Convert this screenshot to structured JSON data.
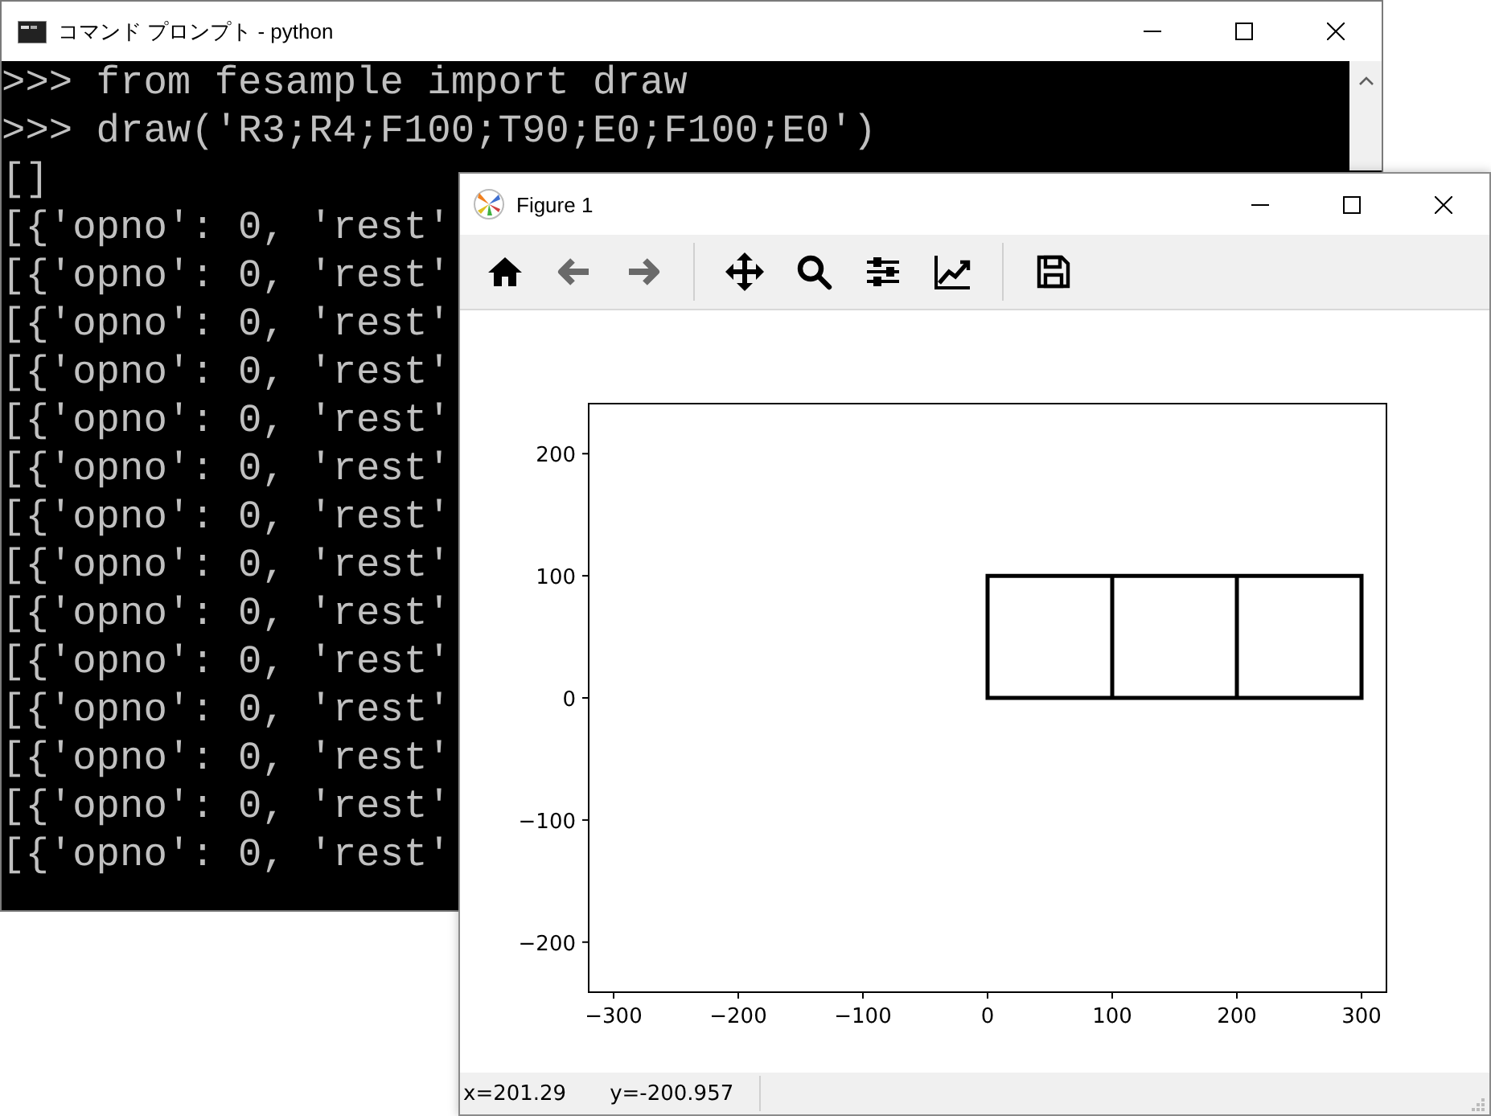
{
  "console_window": {
    "title": "コマンド プロンプト - python",
    "lines": [
      ">>> from fesample import draw",
      ">>> draw('R3;R4;F100;T90;E0;F100;E0')",
      "[]",
      "[{'opno': 0, 'rest'",
      "[{'opno': 0, 'rest'",
      "[{'opno': 0, 'rest'",
      "[{'opno': 0, 'rest'",
      "[{'opno': 0, 'rest'",
      "[{'opno': 0, 'rest'",
      "[{'opno': 0, 'rest'",
      "[{'opno': 0, 'rest'",
      "[{'opno': 0, 'rest'",
      "[{'opno': 0, 'rest'",
      "[{'opno': 0, 'rest'",
      "[{'opno': 0, 'rest'",
      "[{'opno': 0, 'rest'",
      "[{'opno': 0, 'rest'"
    ]
  },
  "figure_window": {
    "title": "Figure 1",
    "toolbar": [
      {
        "kind": "home",
        "disabled": false
      },
      {
        "kind": "back",
        "disabled": true
      },
      {
        "kind": "forward",
        "disabled": true
      },
      {
        "kind": "separator"
      },
      {
        "kind": "pan",
        "disabled": false
      },
      {
        "kind": "zoom",
        "disabled": false
      },
      {
        "kind": "subplots",
        "disabled": false
      },
      {
        "kind": "axes",
        "disabled": false
      },
      {
        "kind": "separator"
      },
      {
        "kind": "save",
        "disabled": false
      }
    ],
    "chart_data": {
      "type": "line",
      "x": [
        0,
        300,
        300,
        0,
        0,
        100,
        100,
        200,
        200
      ],
      "series": [
        {
          "color": "#000000",
          "values": [
            0,
            0,
            100,
            100,
            0,
            0,
            100,
            100,
            0
          ]
        }
      ],
      "xlim": [
        -320,
        320
      ],
      "ylim": [
        -241,
        241
      ],
      "xticks": [
        {
          "value": -300,
          "label": "−300"
        },
        {
          "value": -200,
          "label": "−200"
        },
        {
          "value": -100,
          "label": "−100"
        },
        {
          "value": 0,
          "label": "0"
        },
        {
          "value": 100,
          "label": "100"
        },
        {
          "value": 200,
          "label": "200"
        },
        {
          "value": 300,
          "label": "300"
        }
      ],
      "yticks": [
        {
          "value": -200,
          "label": "−200"
        },
        {
          "value": -100,
          "label": "−100"
        },
        {
          "value": 0,
          "label": "0"
        },
        {
          "value": 100,
          "label": "100"
        },
        {
          "value": 200,
          "label": "200"
        }
      ]
    },
    "status_bar": {
      "x": "x=201.29",
      "y": "y=-200.957"
    }
  }
}
